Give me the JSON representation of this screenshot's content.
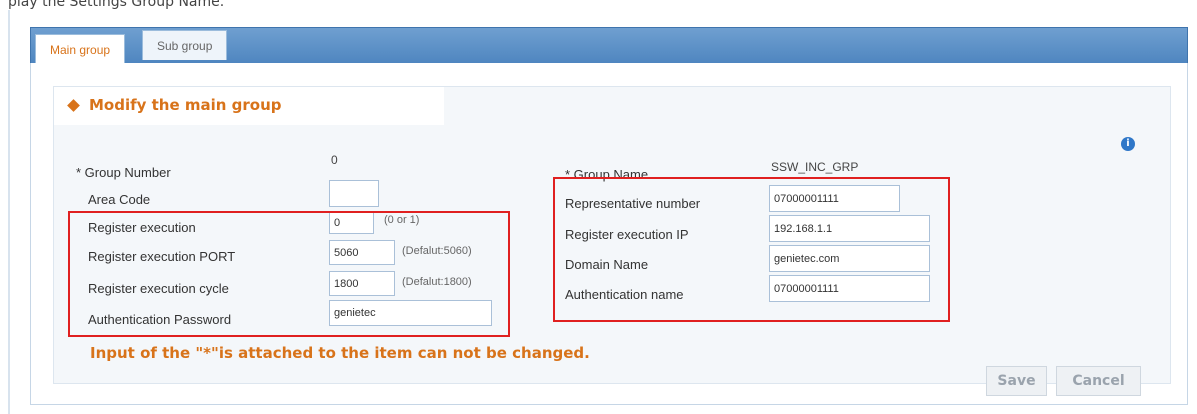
{
  "header": {
    "caption": "play the Settings Group Name."
  },
  "tabs": [
    {
      "label": "Main group",
      "active": true
    },
    {
      "label": "Sub group",
      "active": false
    }
  ],
  "section": {
    "title": "Modify the main group"
  },
  "info_icon": {
    "glyph": "i",
    "name": "info-icon"
  },
  "left_fields": {
    "group_number": {
      "label": "* Group Number",
      "value": "0"
    },
    "area_code": {
      "label": "Area Code",
      "value": ""
    },
    "register_execution": {
      "label": "Register execution",
      "value": "0",
      "hint": "(0  or  1)"
    },
    "register_execution_port": {
      "label": "Register execution PORT",
      "value": "5060",
      "hint": "(Defalut:5060)"
    },
    "register_execution_cycle": {
      "label": "Register execution cycle",
      "value": "1800",
      "hint": "(Defalut:1800)"
    },
    "authentication_password": {
      "label": "Authentication Password",
      "value": "genietec"
    }
  },
  "right_fields": {
    "group_name": {
      "label": "* Group Name",
      "value": "SSW_INC_GRP"
    },
    "representative_number": {
      "label": "Representative number",
      "value": "07000001111"
    },
    "register_execution_ip": {
      "label": "Register execution IP",
      "value": "192.168.1.1"
    },
    "domain_name": {
      "label": "Domain Name",
      "value": "genietec.com"
    },
    "authentication_name": {
      "label": "Authentication name",
      "value": "07000001111"
    }
  },
  "note": "Input of the \"*\"is attached to the item can not be changed.",
  "buttons": {
    "save": "Save",
    "cancel": "Cancel"
  },
  "colors": {
    "accent": "#d8731a",
    "tab_bar": "#5b8fc6",
    "highlight": "#e02020",
    "info": "#2f77c8"
  }
}
